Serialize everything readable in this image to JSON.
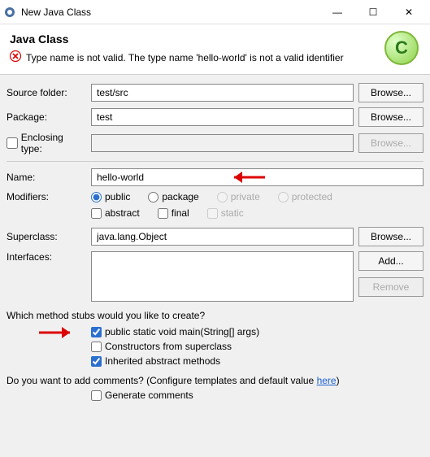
{
  "window": {
    "title": "New Java Class"
  },
  "header": {
    "title": "Java Class",
    "error": "Type name is not valid. The type name 'hello-world' is not a valid identifier",
    "icon_letter": "C"
  },
  "labels": {
    "source_folder": "Source folder:",
    "package": "Package:",
    "enclosing_type": "Enclosing type:",
    "name": "Name:",
    "modifiers": "Modifiers:",
    "superclass": "Superclass:",
    "interfaces": "Interfaces:",
    "method_stubs_q": "Which method stubs would you like to create?",
    "comments_q": "Do you want to add comments? (Configure templates and default value ",
    "here": "here",
    "comments_q_end": ")"
  },
  "values": {
    "source_folder": "test/src",
    "package": "test",
    "enclosing_type": "",
    "name": "hello-world",
    "superclass": "java.lang.Object"
  },
  "buttons": {
    "browse": "Browse...",
    "add": "Add...",
    "remove": "Remove"
  },
  "modifiers": {
    "public": "public",
    "package": "package",
    "private": "private",
    "protected": "protected",
    "abstract": "abstract",
    "final": "final",
    "static": "static"
  },
  "stubs": {
    "main": "public static void main(String[] args)",
    "constructors": "Constructors from superclass",
    "inherited": "Inherited abstract methods"
  },
  "comments": {
    "generate": "Generate comments"
  }
}
